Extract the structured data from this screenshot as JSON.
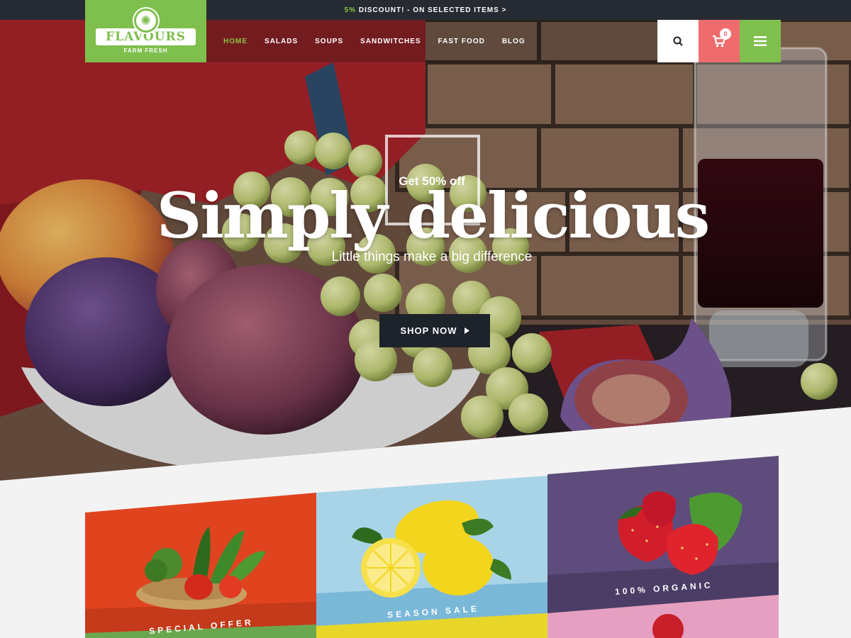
{
  "topbar": {
    "discount": "5%",
    "promo_rest": " DISCOUNT! - ON SELECTED ITEMS >"
  },
  "brand": {
    "name": "FLAVOURS",
    "tagline": "FARM FRESH"
  },
  "nav": {
    "items": [
      {
        "label": "HOME",
        "active": true
      },
      {
        "label": "SALADS"
      },
      {
        "label": "SOUPS"
      },
      {
        "label": "SANDWITCHES"
      },
      {
        "label": "FAST FOOD"
      },
      {
        "label": "BLOG"
      }
    ]
  },
  "header_icons": {
    "search": "search-icon",
    "cart": "cart-icon",
    "cart_count": "0",
    "menu": "hamburger-icon"
  },
  "hero": {
    "offer": "Get 50% off",
    "title": "Simply delicious",
    "subtitle": "Little things make a big difference",
    "cta": "SHOP NOW",
    "cta_icon": "caret-right-icon"
  },
  "tiles": [
    {
      "label": "SPECIAL OFFER",
      "color": "#e0441f",
      "band_color": "#c43a1a"
    },
    {
      "label": "SEASON SALE",
      "color": "#a9d4e8",
      "band_color": "#7ab8d8"
    },
    {
      "label": "100% ORGANIC",
      "color": "#5e4d7c",
      "band_color": "#4b3d66"
    }
  ],
  "colors": {
    "accent_green": "#7fbf4d",
    "cart_red": "#ee6b6e",
    "dark": "#1d232b",
    "nav_active": "#8cc63f"
  }
}
